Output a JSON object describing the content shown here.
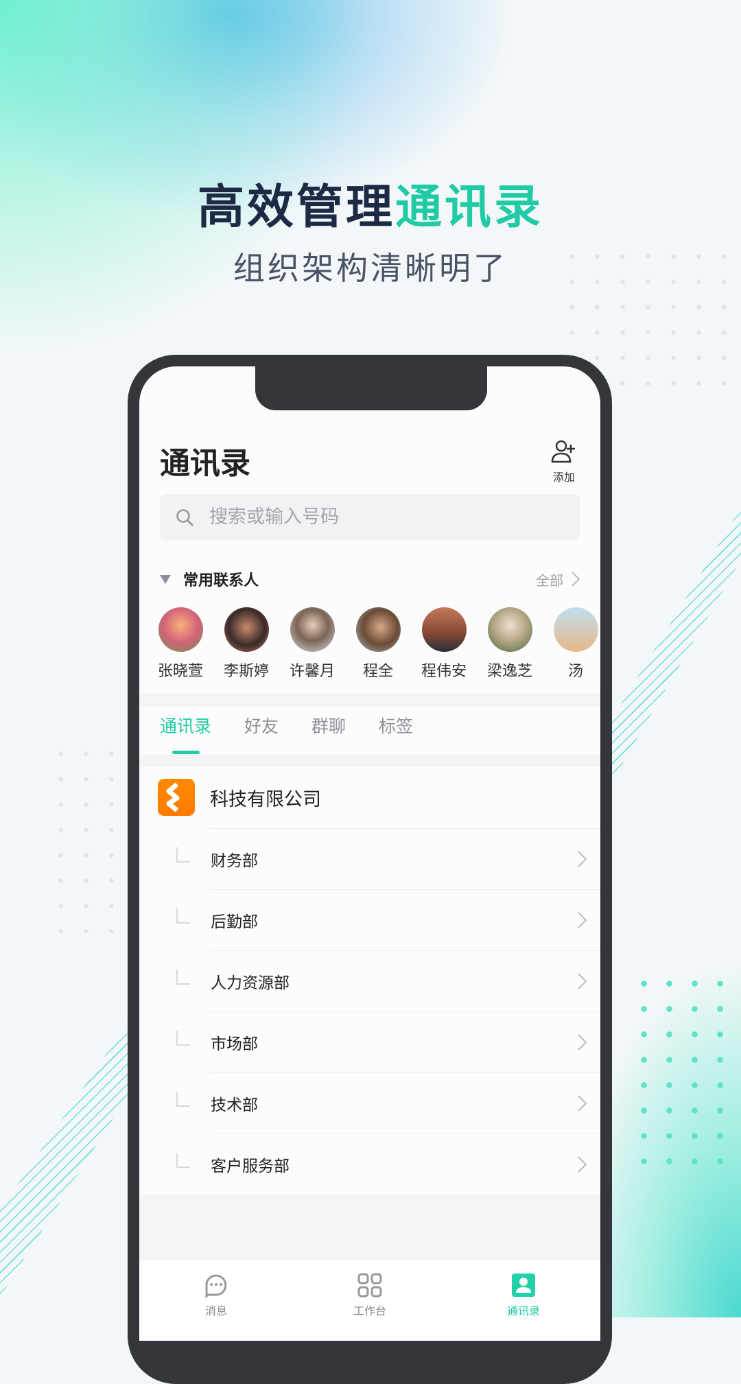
{
  "promo": {
    "headline_a": "高效管理",
    "headline_b": "通讯录",
    "subtitle": "组织架构清晰明了"
  },
  "header": {
    "title": "通讯录",
    "add_label": "添加"
  },
  "search": {
    "placeholder": "搜索或输入号码"
  },
  "frequent": {
    "title": "常用联系人",
    "all_label": "全部",
    "contacts": [
      {
        "name": "张晓萱"
      },
      {
        "name": "李斯婷"
      },
      {
        "name": "许馨月"
      },
      {
        "name": "程全"
      },
      {
        "name": "程伟安"
      },
      {
        "name": "梁逸芝"
      },
      {
        "name": "汤"
      }
    ]
  },
  "tabs": [
    {
      "label": "通讯录",
      "active": true
    },
    {
      "label": "好友"
    },
    {
      "label": "群聊"
    },
    {
      "label": "标签"
    }
  ],
  "company": {
    "name": "科技有限公司",
    "logo_color": "#ff8200"
  },
  "departments": [
    {
      "name": "财务部"
    },
    {
      "name": "后勤部"
    },
    {
      "name": "人力资源部"
    },
    {
      "name": "市场部"
    },
    {
      "name": "技术部"
    },
    {
      "name": "客户服务部"
    }
  ],
  "bottom_nav": [
    {
      "label": "消息",
      "icon": "chat-bubble-icon"
    },
    {
      "label": "工作台",
      "icon": "grid-icon"
    },
    {
      "label": "通讯录",
      "icon": "contacts-icon",
      "active": true
    }
  ],
  "colors": {
    "accent": "#1fcaa4",
    "headline": "#1e2a44"
  }
}
